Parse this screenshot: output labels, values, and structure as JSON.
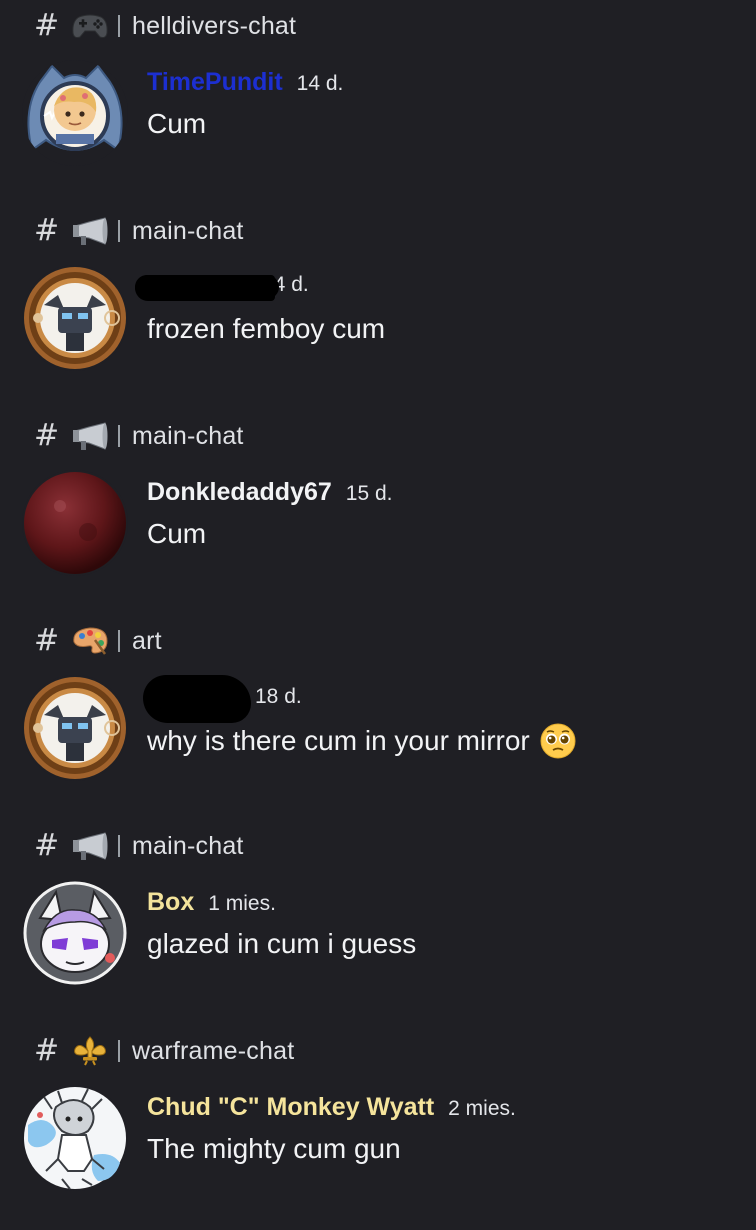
{
  "colors": {
    "background": "#1f1f24",
    "text": "#f2f3f5",
    "timepundit_name": "#1c2fd1",
    "donkle_name": "#f2f3f5",
    "box_name": "#f3e39b",
    "chud_name": "#f5e49c"
  },
  "results": [
    {
      "channel_icon": "video-game-controller-emoji",
      "channel": "helldivers-chat",
      "username": "TimePundit",
      "timestamp": "14 d.",
      "message": "Cum",
      "avatar": "shark-avatar"
    },
    {
      "channel_icon": "loudspeaker-emoji",
      "channel": "main-chat",
      "username": "",
      "timestamp": "14 d.",
      "message": "frozen femboy cum",
      "avatar": "mech-bronze-frame-avatar",
      "redacted_username": true
    },
    {
      "channel_icon": "loudspeaker-emoji",
      "channel": "main-chat",
      "username": "Donkledaddy67",
      "timestamp": "15 d.",
      "message": "Cum",
      "avatar": "red-sphere-avatar"
    },
    {
      "channel_icon": "artist-palette-emoji",
      "channel": "art",
      "username": "",
      "timestamp": "18 d.",
      "message": "why is there cum in your mirror",
      "message_emoji": "pleading-face-emoji",
      "avatar": "mech-bronze-frame-avatar",
      "redacted_username": true
    },
    {
      "channel_icon": "loudspeaker-emoji",
      "channel": "main-chat",
      "username": "Box",
      "timestamp": "1 mies.",
      "message": "glazed in cum i guess",
      "avatar": "anime-cat-girl-avatar"
    },
    {
      "channel_icon": "fleur-de-lis-emoji",
      "channel": "warframe-chat",
      "username": "Chud \"C\" Monkey Wyatt",
      "timestamp": "2 mies.",
      "message": "The mighty cum gun",
      "avatar": "sketch-character-avatar"
    }
  ]
}
